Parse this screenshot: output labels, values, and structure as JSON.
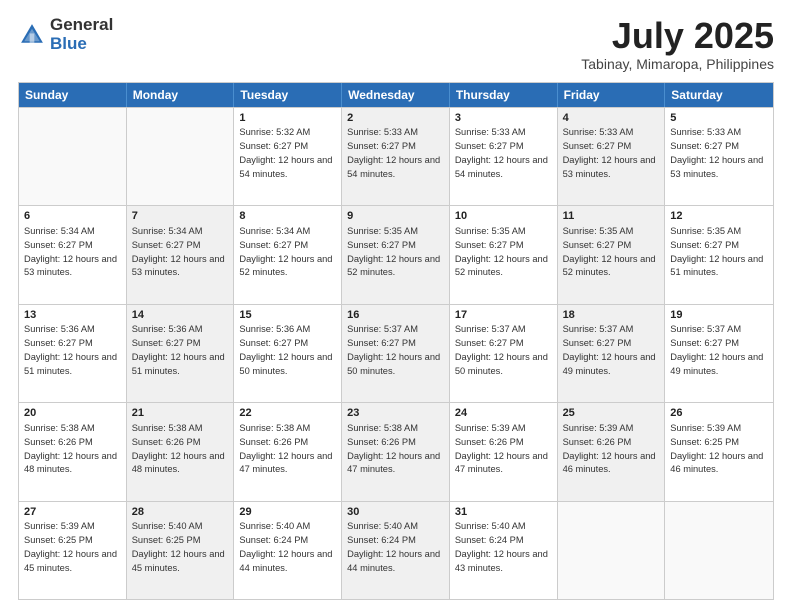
{
  "logo": {
    "general": "General",
    "blue": "Blue"
  },
  "title": "July 2025",
  "subtitle": "Tabinay, Mimaropa, Philippines",
  "header_days": [
    "Sunday",
    "Monday",
    "Tuesday",
    "Wednesday",
    "Thursday",
    "Friday",
    "Saturday"
  ],
  "weeks": [
    [
      {
        "day": "",
        "sunrise": "",
        "sunset": "",
        "daylight": "",
        "shaded": false,
        "empty": true
      },
      {
        "day": "",
        "sunrise": "",
        "sunset": "",
        "daylight": "",
        "shaded": false,
        "empty": true
      },
      {
        "day": "1",
        "sunrise": "Sunrise: 5:32 AM",
        "sunset": "Sunset: 6:27 PM",
        "daylight": "Daylight: 12 hours and 54 minutes.",
        "shaded": false,
        "empty": false
      },
      {
        "day": "2",
        "sunrise": "Sunrise: 5:33 AM",
        "sunset": "Sunset: 6:27 PM",
        "daylight": "Daylight: 12 hours and 54 minutes.",
        "shaded": true,
        "empty": false
      },
      {
        "day": "3",
        "sunrise": "Sunrise: 5:33 AM",
        "sunset": "Sunset: 6:27 PM",
        "daylight": "Daylight: 12 hours and 54 minutes.",
        "shaded": false,
        "empty": false
      },
      {
        "day": "4",
        "sunrise": "Sunrise: 5:33 AM",
        "sunset": "Sunset: 6:27 PM",
        "daylight": "Daylight: 12 hours and 53 minutes.",
        "shaded": true,
        "empty": false
      },
      {
        "day": "5",
        "sunrise": "Sunrise: 5:33 AM",
        "sunset": "Sunset: 6:27 PM",
        "daylight": "Daylight: 12 hours and 53 minutes.",
        "shaded": false,
        "empty": false
      }
    ],
    [
      {
        "day": "6",
        "sunrise": "Sunrise: 5:34 AM",
        "sunset": "Sunset: 6:27 PM",
        "daylight": "Daylight: 12 hours and 53 minutes.",
        "shaded": false,
        "empty": false
      },
      {
        "day": "7",
        "sunrise": "Sunrise: 5:34 AM",
        "sunset": "Sunset: 6:27 PM",
        "daylight": "Daylight: 12 hours and 53 minutes.",
        "shaded": true,
        "empty": false
      },
      {
        "day": "8",
        "sunrise": "Sunrise: 5:34 AM",
        "sunset": "Sunset: 6:27 PM",
        "daylight": "Daylight: 12 hours and 52 minutes.",
        "shaded": false,
        "empty": false
      },
      {
        "day": "9",
        "sunrise": "Sunrise: 5:35 AM",
        "sunset": "Sunset: 6:27 PM",
        "daylight": "Daylight: 12 hours and 52 minutes.",
        "shaded": true,
        "empty": false
      },
      {
        "day": "10",
        "sunrise": "Sunrise: 5:35 AM",
        "sunset": "Sunset: 6:27 PM",
        "daylight": "Daylight: 12 hours and 52 minutes.",
        "shaded": false,
        "empty": false
      },
      {
        "day": "11",
        "sunrise": "Sunrise: 5:35 AM",
        "sunset": "Sunset: 6:27 PM",
        "daylight": "Daylight: 12 hours and 52 minutes.",
        "shaded": true,
        "empty": false
      },
      {
        "day": "12",
        "sunrise": "Sunrise: 5:35 AM",
        "sunset": "Sunset: 6:27 PM",
        "daylight": "Daylight: 12 hours and 51 minutes.",
        "shaded": false,
        "empty": false
      }
    ],
    [
      {
        "day": "13",
        "sunrise": "Sunrise: 5:36 AM",
        "sunset": "Sunset: 6:27 PM",
        "daylight": "Daylight: 12 hours and 51 minutes.",
        "shaded": false,
        "empty": false
      },
      {
        "day": "14",
        "sunrise": "Sunrise: 5:36 AM",
        "sunset": "Sunset: 6:27 PM",
        "daylight": "Daylight: 12 hours and 51 minutes.",
        "shaded": true,
        "empty": false
      },
      {
        "day": "15",
        "sunrise": "Sunrise: 5:36 AM",
        "sunset": "Sunset: 6:27 PM",
        "daylight": "Daylight: 12 hours and 50 minutes.",
        "shaded": false,
        "empty": false
      },
      {
        "day": "16",
        "sunrise": "Sunrise: 5:37 AM",
        "sunset": "Sunset: 6:27 PM",
        "daylight": "Daylight: 12 hours and 50 minutes.",
        "shaded": true,
        "empty": false
      },
      {
        "day": "17",
        "sunrise": "Sunrise: 5:37 AM",
        "sunset": "Sunset: 6:27 PM",
        "daylight": "Daylight: 12 hours and 50 minutes.",
        "shaded": false,
        "empty": false
      },
      {
        "day": "18",
        "sunrise": "Sunrise: 5:37 AM",
        "sunset": "Sunset: 6:27 PM",
        "daylight": "Daylight: 12 hours and 49 minutes.",
        "shaded": true,
        "empty": false
      },
      {
        "day": "19",
        "sunrise": "Sunrise: 5:37 AM",
        "sunset": "Sunset: 6:27 PM",
        "daylight": "Daylight: 12 hours and 49 minutes.",
        "shaded": false,
        "empty": false
      }
    ],
    [
      {
        "day": "20",
        "sunrise": "Sunrise: 5:38 AM",
        "sunset": "Sunset: 6:26 PM",
        "daylight": "Daylight: 12 hours and 48 minutes.",
        "shaded": false,
        "empty": false
      },
      {
        "day": "21",
        "sunrise": "Sunrise: 5:38 AM",
        "sunset": "Sunset: 6:26 PM",
        "daylight": "Daylight: 12 hours and 48 minutes.",
        "shaded": true,
        "empty": false
      },
      {
        "day": "22",
        "sunrise": "Sunrise: 5:38 AM",
        "sunset": "Sunset: 6:26 PM",
        "daylight": "Daylight: 12 hours and 47 minutes.",
        "shaded": false,
        "empty": false
      },
      {
        "day": "23",
        "sunrise": "Sunrise: 5:38 AM",
        "sunset": "Sunset: 6:26 PM",
        "daylight": "Daylight: 12 hours and 47 minutes.",
        "shaded": true,
        "empty": false
      },
      {
        "day": "24",
        "sunrise": "Sunrise: 5:39 AM",
        "sunset": "Sunset: 6:26 PM",
        "daylight": "Daylight: 12 hours and 47 minutes.",
        "shaded": false,
        "empty": false
      },
      {
        "day": "25",
        "sunrise": "Sunrise: 5:39 AM",
        "sunset": "Sunset: 6:26 PM",
        "daylight": "Daylight: 12 hours and 46 minutes.",
        "shaded": true,
        "empty": false
      },
      {
        "day": "26",
        "sunrise": "Sunrise: 5:39 AM",
        "sunset": "Sunset: 6:25 PM",
        "daylight": "Daylight: 12 hours and 46 minutes.",
        "shaded": false,
        "empty": false
      }
    ],
    [
      {
        "day": "27",
        "sunrise": "Sunrise: 5:39 AM",
        "sunset": "Sunset: 6:25 PM",
        "daylight": "Daylight: 12 hours and 45 minutes.",
        "shaded": false,
        "empty": false
      },
      {
        "day": "28",
        "sunrise": "Sunrise: 5:40 AM",
        "sunset": "Sunset: 6:25 PM",
        "daylight": "Daylight: 12 hours and 45 minutes.",
        "shaded": true,
        "empty": false
      },
      {
        "day": "29",
        "sunrise": "Sunrise: 5:40 AM",
        "sunset": "Sunset: 6:24 PM",
        "daylight": "Daylight: 12 hours and 44 minutes.",
        "shaded": false,
        "empty": false
      },
      {
        "day": "30",
        "sunrise": "Sunrise: 5:40 AM",
        "sunset": "Sunset: 6:24 PM",
        "daylight": "Daylight: 12 hours and 44 minutes.",
        "shaded": true,
        "empty": false
      },
      {
        "day": "31",
        "sunrise": "Sunrise: 5:40 AM",
        "sunset": "Sunset: 6:24 PM",
        "daylight": "Daylight: 12 hours and 43 minutes.",
        "shaded": false,
        "empty": false
      },
      {
        "day": "",
        "sunrise": "",
        "sunset": "",
        "daylight": "",
        "shaded": true,
        "empty": true
      },
      {
        "day": "",
        "sunrise": "",
        "sunset": "",
        "daylight": "",
        "shaded": false,
        "empty": true
      }
    ]
  ]
}
